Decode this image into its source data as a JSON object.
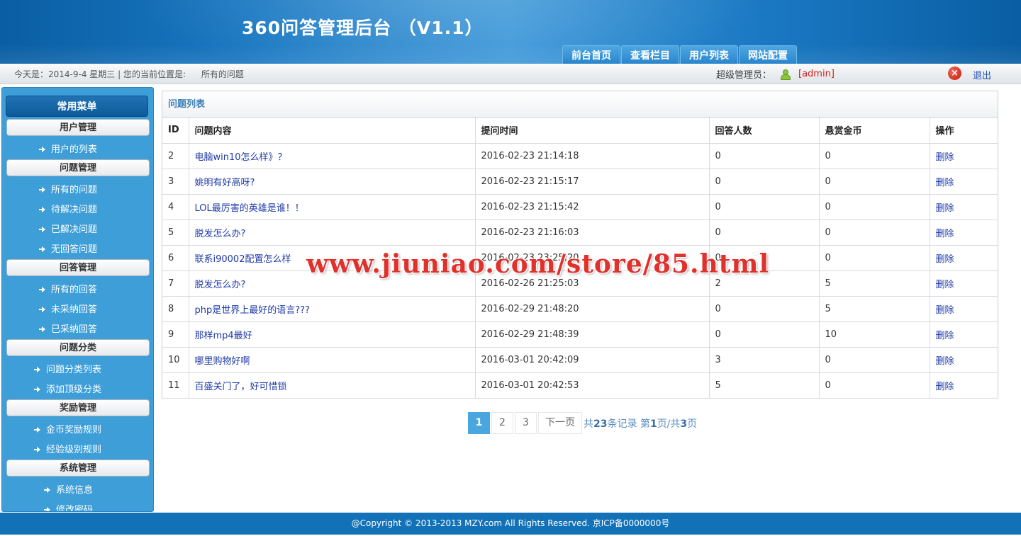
{
  "header": {
    "title": "360问答管理后台 （V1.1）",
    "nav": [
      "前台首页",
      "查看栏目",
      "用户列表",
      "网站配置"
    ]
  },
  "info_bar": {
    "date_text": "今天是：2014-9-4 星期三 | 您的当前位置是:",
    "location": "所有的问题",
    "admin_label": "超级管理员：",
    "admin_name": "[admin]",
    "logout": "退出"
  },
  "sidebar": {
    "title": "常用菜单",
    "groups": [
      {
        "label": "用户管理",
        "items": [
          "用户的列表"
        ]
      },
      {
        "label": "问题管理",
        "items": [
          "所有的问题",
          "待解决问题",
          "已解决问题",
          "无回答问题"
        ]
      },
      {
        "label": "回答管理",
        "items": [
          "所有的回答",
          "未采纳回答",
          "已采纳回答"
        ]
      },
      {
        "label": "问题分类",
        "items": [
          "问题分类列表",
          "添加顶级分类"
        ]
      },
      {
        "label": "奖励管理",
        "items": [
          "金币奖励规则",
          "经验级别规则"
        ]
      },
      {
        "label": "系统管理",
        "items": [
          "系统信息",
          "修改密码"
        ]
      }
    ]
  },
  "panel": {
    "title": "问题列表",
    "columns": [
      "ID",
      "问题内容",
      "提问时间",
      "回答人数",
      "悬赏金币",
      "操作"
    ],
    "rows": [
      [
        "2",
        "电脑win10怎么样》？",
        "2016-02-23 21:14:18",
        "0",
        "0",
        "删除"
      ],
      [
        "3",
        "姚明有好高呀?",
        "2016-02-23 21:15:17",
        "0",
        "0",
        "删除"
      ],
      [
        "4",
        "LOL最厉害的英雄是谁！！",
        "2016-02-23 21:15:42",
        "0",
        "0",
        "删除"
      ],
      [
        "5",
        "脱发怎么办?",
        "2016-02-23 21:16:03",
        "0",
        "0",
        "删除"
      ],
      [
        "6",
        "联系i90002配置怎么样",
        "2016-02-23 23:25:20",
        "0",
        "0",
        "删除"
      ],
      [
        "7",
        "脱发怎么办?",
        "2016-02-26 21:25:03",
        "2",
        "5",
        "删除"
      ],
      [
        "8",
        "php是世界上最好的语言???",
        "2016-02-29 21:48:20",
        "0",
        "5",
        "删除"
      ],
      [
        "9",
        "那样mp4最好",
        "2016-02-29 21:48:39",
        "0",
        "10",
        "删除"
      ],
      [
        "10",
        "哪里购物好啊",
        "2016-03-01 20:42:09",
        "3",
        "0",
        "删除"
      ],
      [
        "11",
        "百盛关门了，好可惜锁",
        "2016-03-01 20:42:53",
        "5",
        "0",
        "删除"
      ]
    ]
  },
  "pagination": {
    "pages": [
      "1",
      "2",
      "3"
    ],
    "current": "1",
    "next": "下一页",
    "total_prefix": "共",
    "total_records": "23",
    "total_suffix": "条记录 第",
    "page_num": "1",
    "page_mid": "页/共",
    "page_total": "3",
    "page_suffix": "页"
  },
  "watermark": "www.jiuniao.com/store/85.html",
  "footer": "@Copyright © 2013-2013 MZY.com All Rights Reserved. 京ICP备0000000号"
}
